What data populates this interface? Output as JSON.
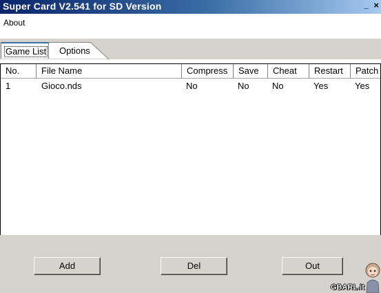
{
  "window": {
    "title": "Super Card V2.541 for SD Version",
    "minimize_glyph": "_",
    "close_glyph": "×"
  },
  "menu": {
    "items": [
      {
        "label": "About"
      }
    ]
  },
  "tabs": [
    {
      "label": "Game List",
      "active": true
    },
    {
      "label": "Options",
      "active": false
    }
  ],
  "table": {
    "columns": [
      "No.",
      "File Name",
      "Compress",
      "Save",
      "Cheat",
      "Restart",
      "Patch"
    ],
    "rows": [
      [
        "1",
        "Gioco.nds",
        "No",
        "No",
        "No",
        "Yes",
        "Yes"
      ]
    ]
  },
  "buttons": {
    "add": "Add",
    "del": "Del",
    "out": "Out"
  },
  "watermark": "GBARL.it",
  "colors": {
    "titlebar_start": "#0a246a",
    "titlebar_end": "#a6caf0",
    "chrome": "#d6d3ce"
  },
  "icons": [
    "minimize-icon",
    "close-icon",
    "mascot-icon"
  ]
}
